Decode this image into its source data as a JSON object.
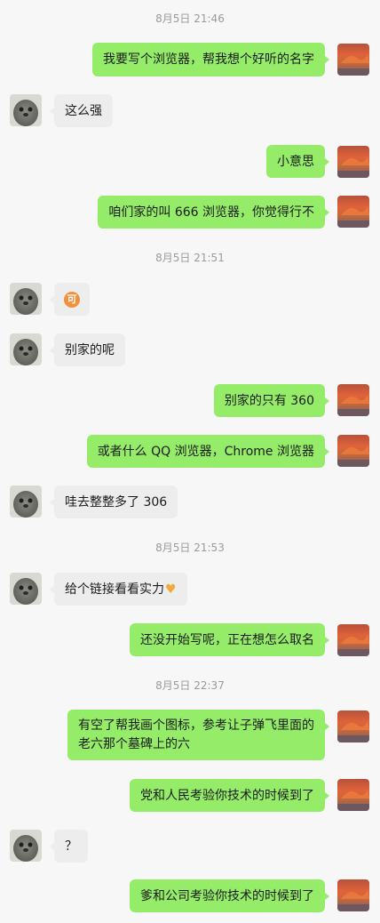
{
  "timestamps": [
    "8月5日 21:46",
    "8月5日 21:51",
    "8月5日 21:53",
    "8月5日 22:37"
  ],
  "messages": [
    {
      "text": "我要写个浏览器，帮我想个好听的名字"
    },
    {
      "text": "这么强"
    },
    {
      "text": "小意思"
    },
    {
      "text": "咱们家的叫 666 浏览器，你觉得行不"
    },
    {
      "text": "可",
      "emoji": "ke-sticker"
    },
    {
      "text": "别家的呢"
    },
    {
      "text": "别家的只有 360"
    },
    {
      "text": "或者什么 QQ 浏览器，Chrome 浏览器"
    },
    {
      "text": "哇去整整多了 306"
    },
    {
      "text": "给个链接看看实力",
      "emoji": "heart-hands-emoji"
    },
    {
      "text": "还没开始写呢，正在想怎么取名"
    },
    {
      "text": "有空了帮我画个图标，参考让子弹飞里面的老六那个墓碑上的六"
    },
    {
      "text": "党和人民考验你技术的时候到了"
    },
    {
      "text": "？"
    },
    {
      "text": "爹和公司考验你技术的时候到了"
    }
  ],
  "colors": {
    "sent_bubble": "#95ec69",
    "received_bubble": "#ededed",
    "background": "#f7f7f7",
    "timestamp": "#9a9a9a"
  }
}
